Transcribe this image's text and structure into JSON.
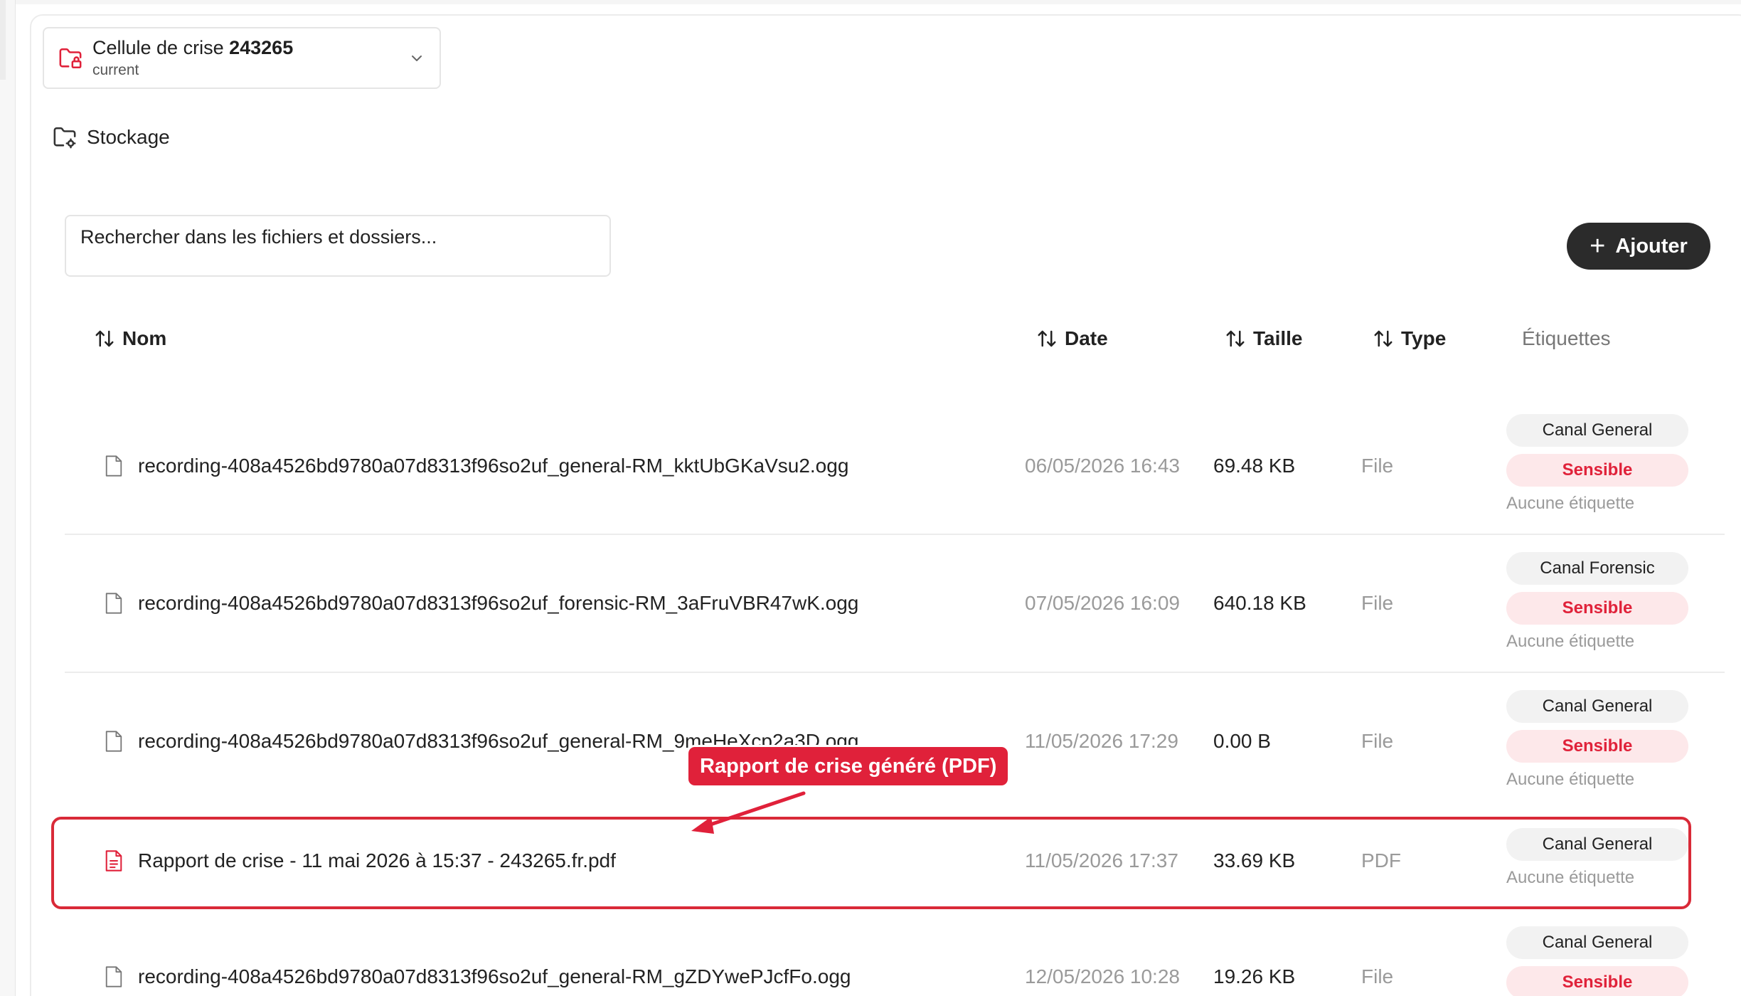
{
  "workspace": {
    "title_prefix": "Cellule de crise",
    "title_id": "243265",
    "subtitle": "current",
    "icon": "folder-lock-icon"
  },
  "section": {
    "label": "Stockage",
    "icon": "folder-settings-icon"
  },
  "search": {
    "placeholder": "Rechercher dans les fichiers et dossiers..."
  },
  "toolbar": {
    "add_label": "Ajouter"
  },
  "table": {
    "headers": {
      "name": "Nom",
      "date": "Date",
      "size": "Taille",
      "type": "Type",
      "tags": "Étiquettes"
    },
    "rows": [
      {
        "name": "recording-408a4526bd9780a07d8313f96so2uf_general-RM_kktUbGKaVsu2.ogg",
        "date": "06/05/2026 16:43",
        "size": "69.48 KB",
        "type": "File",
        "tag_canal": "Canal General",
        "tag_sens": "Sensible",
        "tag_none": "Aucune étiquette"
      },
      {
        "name": "recording-408a4526bd9780a07d8313f96so2uf_forensic-RM_3aFruVBR47wK.ogg",
        "date": "07/05/2026 16:09",
        "size": "640.18 KB",
        "type": "File",
        "tag_canal": "Canal Forensic",
        "tag_sens": "Sensible",
        "tag_none": "Aucune étiquette"
      },
      {
        "name": "recording-408a4526bd9780a07d8313f96so2uf_general-RM_9meHeXcp2a3D.ogg",
        "date": "11/05/2026 17:29",
        "size": "0.00 B",
        "type": "File",
        "tag_canal": "Canal General",
        "tag_sens": "Sensible",
        "tag_none": "Aucune étiquette"
      },
      {
        "name": "Rapport de crise - 11 mai 2026 à 15:37 - 243265.fr.pdf",
        "date": "11/05/2026 17:37",
        "size": "33.69 KB",
        "type": "PDF",
        "tag_canal": "Canal General",
        "tag_none": "Aucune étiquette"
      },
      {
        "name": "recording-408a4526bd9780a07d8313f96so2uf_general-RM_gZDYwePJcfFo.ogg",
        "date": "12/05/2026 10:28",
        "size": "19.26 KB",
        "type": "File",
        "tag_canal": "Canal General",
        "tag_sens": "Sensible"
      }
    ]
  },
  "annotation": {
    "label": "Rapport de crise généré (PDF)",
    "color": "#e0213a"
  },
  "colors": {
    "accent_red": "#e0213a",
    "button_dark": "#2b2b2b"
  }
}
